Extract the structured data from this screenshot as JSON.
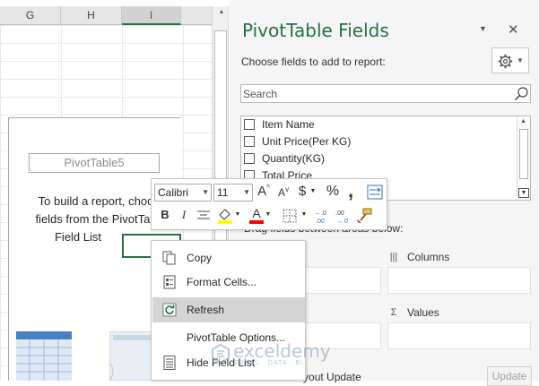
{
  "sheet": {
    "columns": [
      "G",
      "H",
      "I"
    ],
    "pivot_name": "PivotTable5",
    "pivot_message": [
      "To build a report, choo",
      "fields from the PivotTab",
      "Field List"
    ]
  },
  "pane": {
    "title": "PivotTable Fields",
    "subtitle": "Choose fields to add to report:",
    "search_placeholder": "Search",
    "fields": [
      "Item Name",
      "Unit Price(Per KG)",
      "Quantity(KG)",
      "Total Price"
    ],
    "drag_label": "Drag fields between areas below:",
    "areas": {
      "columns": "Columns",
      "values": "Values"
    },
    "defer_label": "Defer Layout Update",
    "update_label": "Update"
  },
  "toolbar": {
    "font": "Calibri",
    "size": "11",
    "grow_font": "A",
    "shrink_font": "A",
    "currency": "$",
    "percent": "%",
    "comma": ",",
    "bold": "B",
    "italic": "I",
    "font_color_label": "A",
    "fill_color": "#ffff00",
    "font_color": "#ff0000"
  },
  "context_menu": {
    "copy": "Copy",
    "format_cells": "Format Cells...",
    "refresh": "Refresh",
    "pivot_options": "PivotTable Options...",
    "hide_field_list": "Hide Field List"
  },
  "watermark": {
    "name": "exceldemy",
    "tagline": "EXCEL · DATA · BI"
  },
  "colors": {
    "accent": "#217346"
  }
}
